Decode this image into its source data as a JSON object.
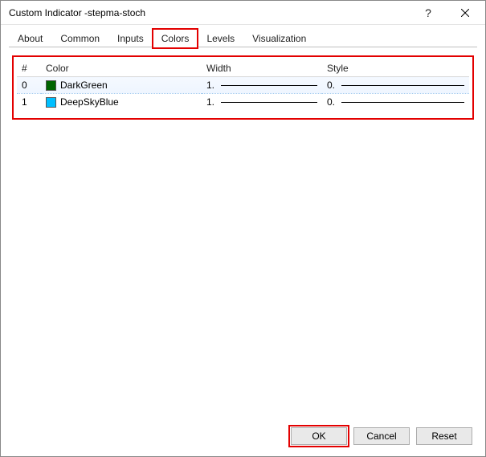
{
  "window": {
    "title_prefix": "Custom Indicator - ",
    "title_name": "stepma-stoch"
  },
  "tabs": {
    "about": "About",
    "common": "Common",
    "inputs": "Inputs",
    "colors": "Colors",
    "levels": "Levels",
    "visualization": "Visualization"
  },
  "table": {
    "headers": {
      "index": "#",
      "color": "Color",
      "width": "Width",
      "style": "Style"
    },
    "rows": [
      {
        "index": "0",
        "color_name": "DarkGreen",
        "swatch": "#006400",
        "width": "1.",
        "style": "0."
      },
      {
        "index": "1",
        "color_name": "DeepSkyBlue",
        "swatch": "#00BFFF",
        "width": "1.",
        "style": "0."
      }
    ]
  },
  "buttons": {
    "ok": "OK",
    "cancel": "Cancel",
    "reset": "Reset"
  }
}
